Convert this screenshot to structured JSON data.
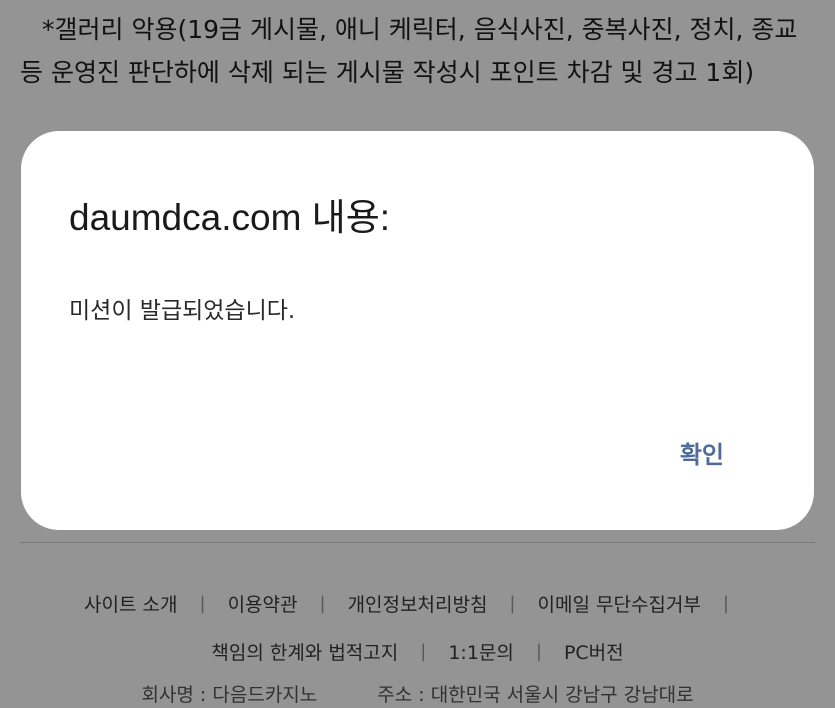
{
  "notice_text": "*갤러리 악용(19금 게시물, 애니 케릭터, 음식사진, 중복사진, 정치, 종교 등 운영진 판단하에 삭제 되는 게시물 작성시 포인트 차감 및 경고 1회)",
  "dialog": {
    "title": "daumdca.com 내용:",
    "message": "미션이 발급되었습니다.",
    "ok_label": "확인"
  },
  "footer": {
    "links_row1": [
      "사이트 소개",
      "이용약관",
      "개인정보처리방침",
      "이메일 무단수집거부"
    ],
    "links_row2": [
      "책임의 한계와 법적고지",
      "1:1문의",
      "PC버전"
    ],
    "separator": "|",
    "company_label": "회사명 : 다음드카지노",
    "address_label": "주소 : 대한민국 서울시 강남구 강남대로"
  }
}
